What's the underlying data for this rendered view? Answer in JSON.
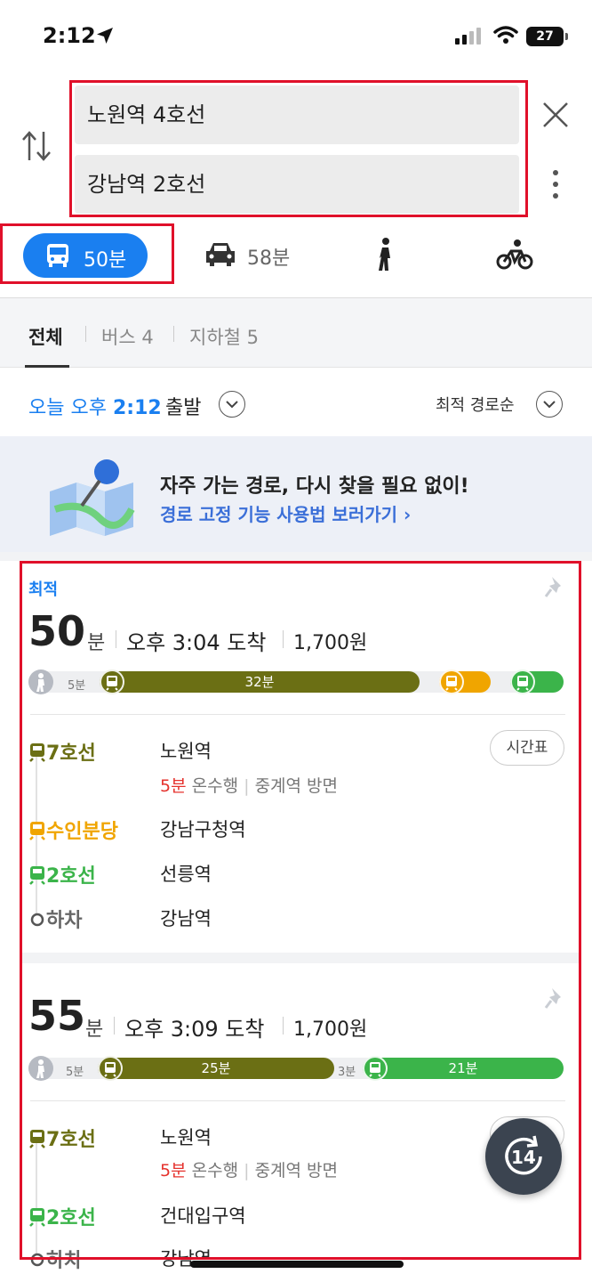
{
  "status": {
    "time": "2:12",
    "battery": "27"
  },
  "search": {
    "start": "노원역 4호선",
    "end": "강남역 2호선"
  },
  "modes": {
    "transit_time": "50분",
    "car_time": "58분"
  },
  "filters": {
    "all": "전체",
    "bus": "버스 4",
    "subway": "지하철 5"
  },
  "departure": {
    "day": "오늘 오후",
    "time": "2:12",
    "suffix": "출발",
    "sort": "최적 경로순"
  },
  "banner": {
    "title": "자주 가는 경로, 다시 찾을 필요 없이!",
    "link": "경로 고정 기능 사용법 보러가기 ›"
  },
  "routes": [
    {
      "tag": "최적",
      "minutes": "50",
      "min_unit": "분",
      "arrival": "오후 3:04 도착",
      "price": "1,700원",
      "bar": {
        "walk": "5분",
        "seg1": "32분"
      },
      "steps": [
        {
          "line": "7호선",
          "station": "노원역",
          "sub_min": "5분",
          "sub_dir": "온수행",
          "sub_toward": "중계역 방면",
          "timetable": "시간표"
        },
        {
          "line": "수인분당",
          "station": "강남구청역"
        },
        {
          "line": "2호선",
          "station": "선릉역"
        },
        {
          "line": "하차",
          "station": "강남역"
        }
      ]
    },
    {
      "minutes": "55",
      "min_unit": "분",
      "arrival": "오후 3:09 도착",
      "price": "1,700원",
      "bar": {
        "walk": "5분",
        "seg1": "25분",
        "walk2": "3분",
        "seg2": "21분"
      },
      "steps": [
        {
          "line": "7호선",
          "station": "노원역",
          "sub_min": "5분",
          "sub_dir": "온수행",
          "sub_toward": "중계역 방면"
        },
        {
          "line": "2호선",
          "station": "건대입구역"
        },
        {
          "line": "하차",
          "station": "강남역"
        }
      ]
    }
  ],
  "fab": {
    "label": "14"
  },
  "colors": {
    "accent": "#1a7ff0",
    "line7": "#6b6f14",
    "suin": "#f0a500",
    "line2": "#3bb44a",
    "highlight": "#e0102a"
  }
}
